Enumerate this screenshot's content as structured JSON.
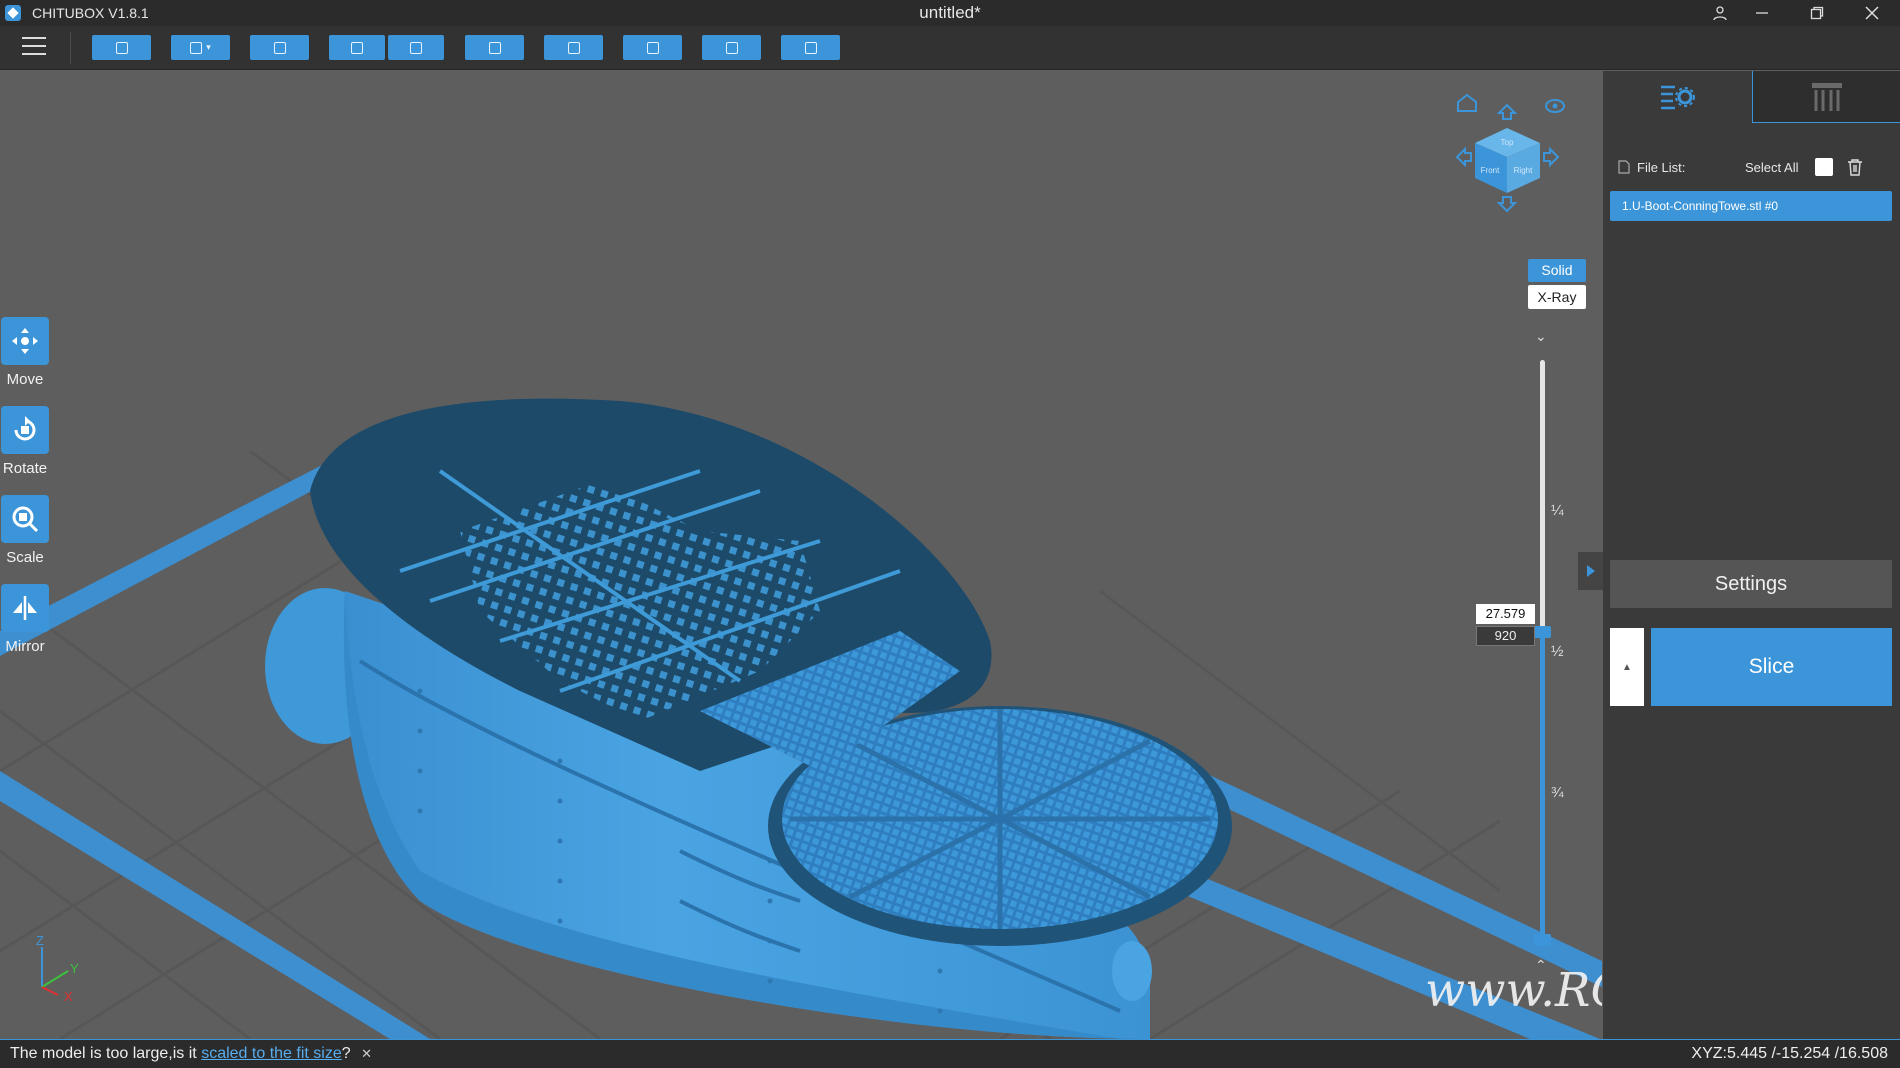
{
  "titlebar": {
    "app_title": "CHITUBOX V1.8.1",
    "doc_title": "untitled*",
    "controls": [
      "user-icon",
      "minimize-icon",
      "restore-icon",
      "close-icon"
    ]
  },
  "toolbar": {
    "buttons": [
      "open-file",
      "save",
      "screenshot",
      "undo",
      "redo",
      "clipboard",
      "duplicate",
      "auto-layout",
      "hollow",
      "compose"
    ],
    "accent": "#3c95d8"
  },
  "left_tools": {
    "move": "Move",
    "rotate": "Rotate",
    "scale": "Scale",
    "mirror": "Mirror"
  },
  "view": {
    "cube_faces": {
      "top": "Top",
      "front": "Front",
      "right": "Right"
    },
    "solid": "Solid",
    "xray": "X-Ray"
  },
  "slider": {
    "height": "27.579",
    "layer": "920",
    "q1": "¼",
    "half": "½",
    "q3": "¾",
    "position_fraction": 0.47
  },
  "panel": {
    "file_list_label": "File List:",
    "select_all_label": "Select All",
    "files": [
      "1.U-Boot-ConningTowe.stl #0"
    ],
    "settings": "Settings",
    "slice": "Slice"
  },
  "status": {
    "message_pre": "The model is too large,is it ",
    "message_link": "scaled to the fit size",
    "message_post": "?",
    "coords": "XYZ:5.445 /-15.254 /16.508"
  },
  "watermark": "www.RCshipyard.com"
}
